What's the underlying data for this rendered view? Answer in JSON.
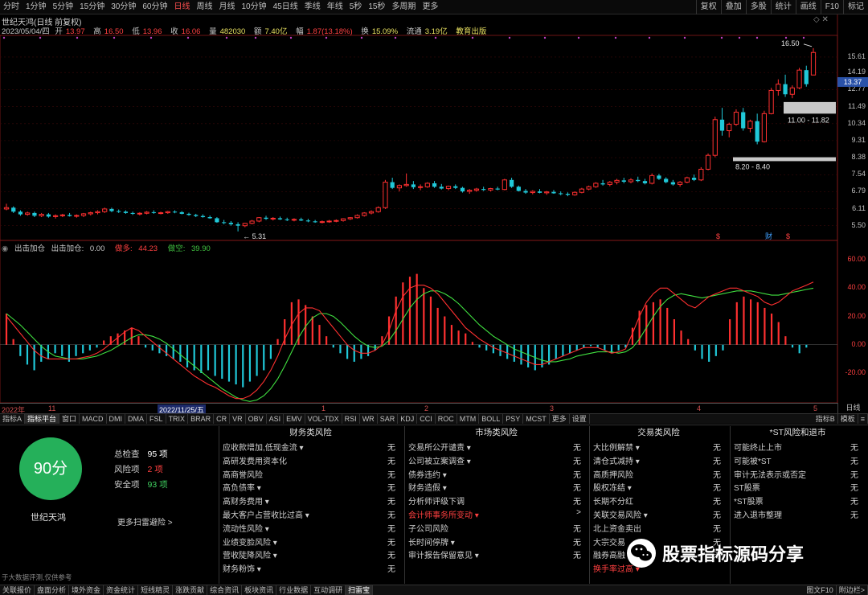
{
  "toolbar": {
    "periods": [
      "分时",
      "1分钟",
      "5分钟",
      "15分钟",
      "30分钟",
      "60分钟",
      "日线",
      "周线",
      "月线",
      "10分钟",
      "45日线",
      "季线",
      "年线",
      "5秒",
      "15秒",
      "多周期",
      "更多"
    ],
    "active_period": "日线",
    "right_tools": [
      "复权",
      "叠加",
      "多股",
      "统计",
      "画线",
      "F10",
      "标记"
    ]
  },
  "chart": {
    "title": "世纪天鸿(日线 前复权)",
    "quote": {
      "date": "2023/05/04/四",
      "open_lbl": "开",
      "open": "13.97",
      "high_lbl": "高",
      "high": "16.50",
      "low_lbl": "低",
      "low": "13.96",
      "close_lbl": "收",
      "close": "16.06",
      "vol_lbl": "量",
      "vol": "482030",
      "amt_lbl": "额",
      "amt": "7.40亿",
      "chg_lbl": "幅",
      "chg": "1.87(13.18%)",
      "turn_lbl": "换",
      "turn": "15.09%",
      "float_lbl": "流通",
      "float": "3.19亿",
      "tag": "教育出版"
    },
    "price_ticks": [
      "15.61",
      "14.19",
      "12.77",
      "11.49",
      "10.34",
      "9.31",
      "8.38",
      "7.54",
      "6.79",
      "6.11",
      "5.50"
    ],
    "current_price": "13.37",
    "annotations": {
      "high_label": "16.50",
      "low_label": "5.31",
      "box1_label": "11.00 - 11.82",
      "box2_label": "8.20 - 8.40"
    },
    "event_marks": [
      "$",
      "财",
      "$"
    ]
  },
  "indicator": {
    "name": "出击加仓",
    "header_name": "出击加仓:",
    "header_value": "0.00",
    "long_lbl": "做多:",
    "long_val": "44.23",
    "short_lbl": "做空:",
    "short_val": "39.90",
    "ticks": [
      "60.00",
      "40.00",
      "20.00",
      "0.00",
      "-20.00"
    ]
  },
  "date_bar": {
    "labels": [
      "2022年",
      "11",
      "2022/11/25/五",
      "1",
      "2",
      "3",
      "4",
      "5"
    ],
    "period_button": "日线"
  },
  "indicator_tabs": {
    "items": [
      "指标A",
      "指标平台",
      "窗口",
      "MACD",
      "DMI",
      "DMA",
      "FSL",
      "TRIX",
      "BRAR",
      "CR",
      "VR",
      "OBV",
      "ASI",
      "EMV",
      "VOL-TDX",
      "RSI",
      "WR",
      "SAR",
      "KDJ",
      "CCI",
      "ROC",
      "MTM",
      "BOLL",
      "PSY",
      "MCST",
      "更多",
      "设置"
    ],
    "active": "指标平台",
    "right_items": [
      "指标B",
      "模板",
      "≡"
    ]
  },
  "score_panel": {
    "score": "90分",
    "stock_name": "世纪天鸿",
    "total_lbl": "总检查",
    "total_val": "95 项",
    "risk_lbl": "风险项",
    "risk_val": "2 项",
    "safe_lbl": "安全项",
    "safe_val": "93 项",
    "more": "更多扫雷避险 >",
    "disclaimer": "于大数据评测,仅供参考"
  },
  "risk_columns": [
    {
      "title": "财务类风险",
      "items": [
        {
          "label": "应收款增加,低现金流 ▾",
          "value": "无",
          "hl": false
        },
        {
          "label": "高研发费用资本化",
          "value": "无",
          "hl": false
        },
        {
          "label": "高商誉风险",
          "value": "无",
          "hl": false
        },
        {
          "label": "高负债率 ▾",
          "value": "无",
          "hl": false
        },
        {
          "label": "高财务费用 ▾",
          "value": "无",
          "hl": false
        },
        {
          "label": "最大客户占营收比过高 ▾",
          "value": "无",
          "hl": false
        },
        {
          "label": "流动性风险 ▾",
          "value": "无",
          "hl": false
        },
        {
          "label": "业绩变脸风险 ▾",
          "value": "无",
          "hl": false
        },
        {
          "label": "营收陡降风险 ▾",
          "value": "无",
          "hl": false
        },
        {
          "label": "财务粉饰 ▾",
          "value": "无",
          "hl": false
        }
      ]
    },
    {
      "title": "市场类风险",
      "items": [
        {
          "label": "交易所公开谴责 ▾",
          "value": "无",
          "hl": false
        },
        {
          "label": "公司被立案调查 ▾",
          "value": "无",
          "hl": false
        },
        {
          "label": "债券违约 ▾",
          "value": "无",
          "hl": false
        },
        {
          "label": "财务造假 ▾",
          "value": "无",
          "hl": false
        },
        {
          "label": "分析师评级下调",
          "value": "无",
          "hl": false
        },
        {
          "label": "会计师事务所变动 ▾",
          "value": ">",
          "hl": true
        },
        {
          "label": "子公司风险",
          "value": "无",
          "hl": false
        },
        {
          "label": "长时间停牌 ▾",
          "value": "无",
          "hl": false
        },
        {
          "label": "审计报告保留意见 ▾",
          "value": "无",
          "hl": false
        }
      ]
    },
    {
      "title": "交易类风险",
      "items": [
        {
          "label": "大比例解禁 ▾",
          "value": "无",
          "hl": false
        },
        {
          "label": "清仓式减持 ▾",
          "value": "无",
          "hl": false
        },
        {
          "label": "高质押风险",
          "value": "无",
          "hl": false
        },
        {
          "label": "股权冻结 ▾",
          "value": "无",
          "hl": false
        },
        {
          "label": "长期不分红",
          "value": "无",
          "hl": false
        },
        {
          "label": "关联交易风险 ▾",
          "value": "无",
          "hl": false
        },
        {
          "label": "北上资金卖出",
          "value": "无",
          "hl": false
        },
        {
          "label": "大宗交易",
          "value": "无",
          "hl": false
        },
        {
          "label": "融券高融",
          "value": "无",
          "hl": false
        },
        {
          "label": "换手率过高 ▾",
          "value": "",
          "hl": true
        }
      ]
    },
    {
      "title": "*ST风险和退市",
      "items": [
        {
          "label": "可能终止上市",
          "value": "无",
          "hl": false
        },
        {
          "label": "可能被*ST",
          "value": "无",
          "hl": false
        },
        {
          "label": "审计无法表示或否定",
          "value": "无",
          "hl": false
        },
        {
          "label": "ST股票",
          "value": "无",
          "hl": false
        },
        {
          "label": "*ST股票",
          "value": "无",
          "hl": false
        },
        {
          "label": "进入退市整理",
          "value": "无",
          "hl": false
        }
      ]
    }
  ],
  "watermark": "股票指标源码分享",
  "bottom_nav": {
    "items": [
      "关联报价",
      "盘面分析",
      "境外资金",
      "资金统计",
      "短线精灵",
      "涨跌贡献",
      "综合资讯",
      "板块资讯",
      "行业数据",
      "互动调研",
      "扫雷宝"
    ],
    "active": "扫雷宝",
    "right_items": [
      "图文F10",
      "附边栏>"
    ]
  },
  "colors": {
    "up": "#ff3030",
    "down": "#20c8d8",
    "long_line": "#ff3030",
    "short_line": "#40e040",
    "score": "#25b05a",
    "axis_bg": "#2a52a8"
  },
  "chart_data": {
    "type": "candlestick",
    "candles": [
      [
        6.1,
        6.3,
        6.05,
        6.15
      ],
      [
        6.15,
        6.2,
        5.95,
        6.0
      ],
      [
        6.0,
        6.05,
        5.85,
        5.9
      ],
      [
        5.9,
        6.0,
        5.85,
        5.95
      ],
      [
        5.95,
        6.0,
        5.8,
        5.85
      ],
      [
        5.85,
        5.95,
        5.8,
        5.9
      ],
      [
        5.9,
        5.95,
        5.78,
        5.82
      ],
      [
        5.82,
        5.9,
        5.75,
        5.85
      ],
      [
        5.85,
        5.92,
        5.8,
        5.88
      ],
      [
        5.88,
        5.95,
        5.82,
        5.84
      ],
      [
        5.84,
        5.9,
        5.78,
        5.86
      ],
      [
        5.86,
        5.95,
        5.8,
        5.92
      ],
      [
        5.92,
        6.0,
        5.86,
        5.96
      ],
      [
        5.96,
        6.05,
        5.9,
        6.0
      ],
      [
        6.0,
        6.15,
        5.95,
        6.1
      ],
      [
        6.1,
        6.15,
        5.98,
        6.02
      ],
      [
        6.02,
        6.08,
        5.95,
        6.0
      ],
      [
        6.0,
        6.05,
        5.92,
        5.95
      ],
      [
        5.95,
        6.0,
        5.88,
        5.92
      ],
      [
        5.92,
        5.98,
        5.86,
        5.94
      ],
      [
        5.94,
        6.02,
        5.9,
        5.98
      ],
      [
        5.98,
        6.05,
        5.92,
        5.95
      ],
      [
        5.95,
        6.0,
        5.9,
        5.96
      ],
      [
        5.96,
        6.03,
        5.92,
        6.0
      ],
      [
        6.0,
        6.05,
        5.94,
        5.98
      ],
      [
        5.98,
        6.02,
        5.9,
        5.92
      ],
      [
        5.92,
        5.96,
        5.85,
        5.88
      ],
      [
        5.88,
        5.92,
        5.8,
        5.84
      ],
      [
        5.84,
        5.9,
        5.78,
        5.8
      ],
      [
        5.8,
        5.86,
        5.74,
        5.76
      ],
      [
        5.76,
        5.8,
        5.6,
        5.62
      ],
      [
        5.62,
        5.7,
        5.55,
        5.6
      ],
      [
        5.6,
        5.66,
        5.5,
        5.55
      ],
      [
        5.55,
        5.62,
        5.31,
        5.5
      ],
      [
        5.5,
        5.6,
        5.45,
        5.58
      ],
      [
        5.58,
        5.7,
        5.55,
        5.66
      ],
      [
        5.66,
        5.8,
        5.62,
        5.78
      ],
      [
        5.78,
        5.85,
        5.7,
        5.74
      ],
      [
        5.74,
        5.8,
        5.68,
        5.76
      ],
      [
        5.76,
        5.82,
        5.7,
        5.72
      ],
      [
        5.72,
        5.78,
        5.66,
        5.7
      ],
      [
        5.7,
        5.76,
        5.65,
        5.72
      ],
      [
        5.72,
        5.78,
        5.66,
        5.68
      ],
      [
        5.68,
        5.74,
        5.62,
        5.65
      ],
      [
        5.65,
        5.7,
        5.6,
        5.62
      ],
      [
        5.62,
        5.68,
        5.58,
        5.64
      ],
      [
        5.64,
        5.7,
        5.6,
        5.66
      ],
      [
        5.66,
        5.72,
        5.62,
        5.68
      ],
      [
        5.68,
        5.76,
        5.64,
        5.74
      ],
      [
        5.74,
        5.8,
        5.7,
        5.78
      ],
      [
        5.78,
        5.9,
        5.75,
        5.86
      ],
      [
        5.86,
        5.98,
        5.82,
        5.95
      ],
      [
        5.95,
        6.05,
        5.9,
        6.0
      ],
      [
        6.0,
        6.2,
        5.96,
        6.15
      ],
      [
        6.15,
        7.3,
        6.1,
        7.2
      ],
      [
        7.2,
        7.4,
        6.9,
        6.95
      ],
      [
        6.95,
        7.1,
        6.8,
        7.05
      ],
      [
        7.05,
        7.6,
        7.0,
        7.1
      ],
      [
        7.1,
        7.25,
        6.9,
        6.98
      ],
      [
        6.98,
        7.1,
        6.85,
        7.0
      ],
      [
        7.0,
        7.2,
        6.95,
        7.15
      ],
      [
        7.15,
        7.25,
        6.95,
        7.0
      ],
      [
        7.0,
        7.12,
        6.88,
        6.92
      ],
      [
        6.92,
        7.05,
        6.85,
        7.02
      ],
      [
        7.02,
        7.1,
        6.9,
        6.95
      ],
      [
        6.95,
        7.0,
        6.75,
        6.8
      ],
      [
        6.8,
        6.9,
        6.7,
        6.85
      ],
      [
        6.85,
        6.95,
        6.78,
        6.9
      ],
      [
        6.9,
        7.0,
        6.82,
        6.86
      ],
      [
        6.86,
        6.95,
        6.8,
        6.92
      ],
      [
        6.92,
        7.0,
        6.85,
        6.88
      ],
      [
        6.88,
        7.35,
        6.85,
        7.3
      ],
      [
        7.3,
        7.4,
        6.95,
        7.0
      ],
      [
        7.0,
        7.05,
        6.8,
        6.82
      ],
      [
        6.82,
        6.9,
        6.7,
        6.75
      ],
      [
        6.75,
        6.85,
        6.68,
        6.8
      ],
      [
        6.8,
        6.9,
        6.72,
        6.74
      ],
      [
        6.74,
        6.82,
        6.66,
        6.78
      ],
      [
        6.78,
        6.86,
        6.7,
        6.72
      ],
      [
        6.72,
        6.8,
        6.64,
        6.7
      ],
      [
        6.7,
        6.76,
        6.6,
        6.66
      ],
      [
        6.66,
        6.8,
        6.62,
        6.76
      ],
      [
        6.76,
        6.95,
        6.72,
        6.9
      ],
      [
        6.9,
        7.05,
        6.85,
        7.0
      ],
      [
        7.0,
        7.2,
        6.95,
        7.15
      ],
      [
        7.15,
        7.3,
        7.05,
        7.1
      ],
      [
        7.1,
        7.25,
        7.02,
        7.2
      ],
      [
        7.2,
        7.35,
        7.1,
        7.28
      ],
      [
        7.28,
        7.4,
        7.15,
        7.22
      ],
      [
        7.22,
        7.38,
        7.15,
        7.3
      ],
      [
        7.3,
        7.45,
        7.2,
        7.25
      ],
      [
        7.25,
        7.35,
        7.1,
        7.15
      ],
      [
        7.15,
        7.6,
        7.1,
        7.5
      ],
      [
        7.5,
        7.58,
        7.3,
        7.35
      ],
      [
        7.35,
        7.42,
        7.15,
        7.2
      ],
      [
        7.2,
        7.3,
        7.05,
        7.1
      ],
      [
        7.1,
        7.25,
        7.0,
        7.2
      ],
      [
        7.2,
        7.45,
        7.15,
        7.4
      ],
      [
        7.4,
        7.55,
        7.25,
        7.3
      ],
      [
        7.3,
        7.9,
        7.25,
        7.8
      ],
      [
        7.8,
        8.6,
        7.75,
        8.5
      ],
      [
        8.5,
        10.8,
        8.4,
        10.6
      ],
      [
        10.6,
        11.4,
        9.6,
        9.9
      ],
      [
        9.9,
        10.4,
        9.5,
        10.3
      ],
      [
        10.3,
        11.3,
        10.2,
        11.1
      ],
      [
        11.1,
        11.4,
        9.9,
        10.05
      ],
      [
        10.05,
        10.6,
        9.8,
        10.5
      ],
      [
        10.5,
        11.0,
        9.1,
        9.25
      ],
      [
        9.25,
        11.2,
        9.2,
        11.0
      ],
      [
        11.0,
        12.9,
        10.95,
        12.7
      ],
      [
        12.7,
        13.6,
        12.3,
        13.2
      ],
      [
        13.2,
        14.0,
        12.2,
        12.4
      ],
      [
        12.4,
        13.1,
        12.1,
        12.9
      ],
      [
        12.9,
        14.6,
        12.8,
        14.4
      ],
      [
        14.4,
        14.8,
        13.0,
        13.2
      ],
      [
        13.97,
        16.5,
        13.96,
        16.06
      ]
    ],
    "indicator": {
      "bars": [
        22,
        4,
        -8,
        -14,
        -18,
        -12,
        -10,
        -6,
        -8,
        -12,
        -8,
        -6,
        -4,
        -2,
        3,
        6,
        8,
        10,
        12,
        6,
        -2,
        -4,
        -6,
        -8,
        -10,
        -12,
        -16,
        -18,
        -20,
        -18,
        -22,
        -24,
        -26,
        -28,
        -30,
        -26,
        -22,
        -18,
        -10,
        4,
        18,
        30,
        32,
        28,
        20,
        14,
        6,
        -2,
        -6,
        -10,
        -12,
        -10,
        -8,
        -4,
        6,
        20,
        34,
        44,
        48,
        50,
        40,
        34,
        26,
        20,
        14,
        10,
        8,
        2,
        -2,
        -4,
        -6,
        -8,
        -10,
        -12,
        -14,
        -16,
        -18,
        -16,
        -14,
        -10,
        -8,
        -6,
        -4,
        -2,
        -1,
        -2,
        -4,
        -6,
        -4,
        -2,
        12,
        24,
        28,
        30,
        32,
        26,
        18,
        10,
        4,
        -4,
        -10,
        -12,
        -8,
        -4,
        18,
        30,
        34,
        32,
        30,
        26,
        22,
        16,
        6,
        -2,
        -6,
        -2,
        0
      ],
      "long_line": [
        20,
        14,
        8,
        2,
        -4,
        -8,
        -10,
        -10,
        -10,
        -10,
        -10,
        -9,
        -8,
        -6,
        -3,
        1,
        5,
        9,
        12,
        10,
        6,
        2,
        -2,
        -6,
        -10,
        -14,
        -18,
        -22,
        -25,
        -28,
        -30,
        -33,
        -36,
        -38,
        -38,
        -36,
        -32,
        -26,
        -18,
        -8,
        4,
        14,
        22,
        26,
        26,
        24,
        18,
        12,
        6,
        0,
        -4,
        -6,
        -6,
        -4,
        0,
        10,
        24,
        34,
        40,
        42,
        42,
        40,
        36,
        30,
        24,
        18,
        12,
        8,
        4,
        1,
        -2,
        -4,
        -6,
        -8,
        -10,
        -12,
        -14,
        -14,
        -12,
        -10,
        -8,
        -6,
        -4,
        -2,
        -2,
        -2,
        -4,
        -6,
        -5,
        -3,
        8,
        20,
        30,
        36,
        40,
        40,
        36,
        32,
        28,
        26,
        30,
        34,
        36,
        38,
        40,
        40,
        38,
        36,
        34,
        30,
        28,
        30,
        34,
        38,
        40,
        42,
        44.23
      ],
      "short_line": [
        22,
        18,
        14,
        9,
        4,
        -1,
        -5,
        -8,
        -9,
        -10,
        -10,
        -10,
        -9,
        -8,
        -6,
        -4,
        -1,
        2,
        5,
        7,
        7,
        6,
        4,
        1,
        -3,
        -7,
        -11,
        -15,
        -19,
        -23,
        -27,
        -31,
        -34,
        -37,
        -39,
        -40,
        -39,
        -36,
        -31,
        -24,
        -15,
        -5,
        5,
        13,
        19,
        22,
        22,
        20,
        16,
        11,
        6,
        2,
        -1,
        -2,
        -1,
        3,
        10,
        18,
        26,
        32,
        36,
        38,
        38,
        36,
        33,
        29,
        24,
        19,
        14,
        10,
        6,
        3,
        0,
        -3,
        -5,
        -7,
        -9,
        -11,
        -12,
        -12,
        -11,
        -10,
        -8,
        -7,
        -6,
        -5,
        -5,
        -5,
        -6,
        -5,
        -2,
        4,
        12,
        20,
        27,
        32,
        35,
        36,
        35,
        34,
        33,
        34,
        35,
        36,
        37,
        38,
        38,
        38,
        37,
        36,
        35,
        35,
        36,
        37,
        38,
        39,
        39.9
      ]
    }
  }
}
